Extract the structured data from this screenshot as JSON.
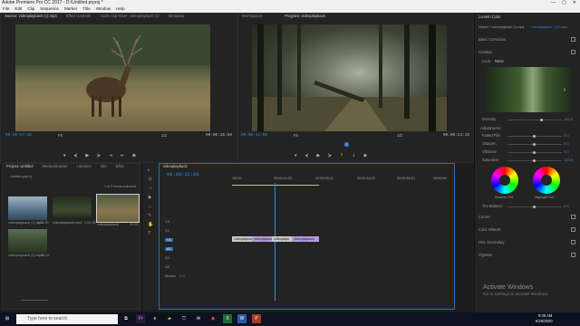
{
  "window": {
    "title": "Adobe Premiere Pro CC 2017 - D:\\Untitled.prproj *",
    "controls": [
      "—",
      "▢",
      "✕"
    ]
  },
  "menu": [
    "File",
    "Edit",
    "Clip",
    "Sequence",
    "Marker",
    "Title",
    "Window",
    "Help"
  ],
  "source_panel": {
    "tabs": [
      "Source: videoplayback (1).mp4",
      "Effect Controls",
      "Audio Clip Mixer: videoplayback (1)",
      "Metadata"
    ],
    "timecode_left": "00:00:07:16",
    "fit": "Fit",
    "ratio": "1/2",
    "timecode_right": "00:00:35:00"
  },
  "program_panel": {
    "tabs": [
      "Workspaces",
      "Program: videoplayback"
    ],
    "timecode_left": "00:00:12:08",
    "fit": "Fit",
    "ratio": "1/2",
    "timecode_right": "00:00:24:15"
  },
  "project_panel": {
    "tabs": [
      "Project: Untitled",
      "Media Browser",
      "Libraries",
      "Info",
      "Effec"
    ],
    "path": "Untitled.prproj",
    "count": "1 of 4 items selected",
    "items": [
      {
        "name": "videoplayback (1).mp4",
        "dur": "1:21:00"
      },
      {
        "name": "videoplayback.mp4",
        "dur": "1:24:05"
      },
      {
        "name": "videoplayback",
        "dur": "24:15"
      },
      {
        "name": "videoplayback (2).mp4",
        "dur": "28:13"
      }
    ]
  },
  "timeline": {
    "tab": "videoplayback",
    "timecode": "00:00:12:08",
    "ruler": [
      ":00:00",
      "00:00:14:23",
      "00:00:29:22",
      "00:00:44:22",
      "00:00:59:21",
      "00:01:14:21",
      "00:00:59"
    ],
    "tracks": [
      "V3",
      "V2",
      "V1",
      "A1",
      "A2",
      "A3",
      "Master"
    ],
    "master_val": "0.0",
    "clips": [
      "videoplayback",
      "videoplayback",
      "videoplayb",
      "videoplayback"
    ]
  },
  "lumetri": {
    "title": "Lumetri Color",
    "master": "Master * videoplayback (1).mp4",
    "seq": "videoplayback * (1)*.mp4",
    "sections": [
      "Basic Correction",
      "Creative",
      "Curves",
      "Color Wheels",
      "HSL Secondary",
      "Vignette"
    ],
    "look_label": "Look",
    "look_value": "None",
    "intensity_label": "Intensity",
    "intensity": "100.0",
    "adjustments": "Adjustments",
    "adj": [
      {
        "l": "Faded Film",
        "v": "0.0"
      },
      {
        "l": "Sharpen",
        "v": "0.0"
      },
      {
        "l": "Vibrance",
        "v": "0.0"
      },
      {
        "l": "Saturation",
        "v": "100.0"
      }
    ],
    "shadow": "Shadow Tint",
    "highlight": "Highlight Tint",
    "tint_balance": "Tint Balance",
    "tint_val": "0.0"
  },
  "activate": {
    "title": "Activate Windows",
    "sub": "Go to Settings to activate Windows."
  },
  "taskbar": {
    "search": "Type here to search",
    "time": "9:45 AM",
    "date": "5/26/2020"
  }
}
